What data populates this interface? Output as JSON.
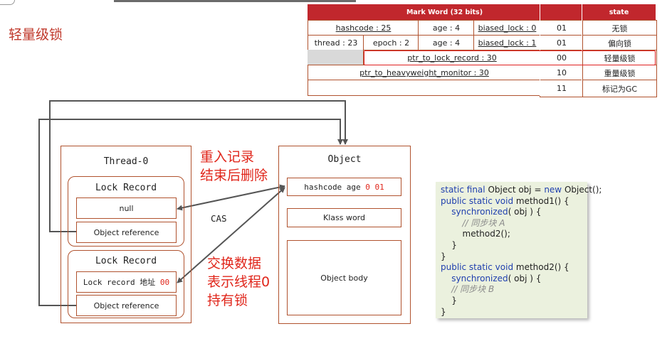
{
  "title": "轻量级锁",
  "mark_word": {
    "header": "Mark Word (32 bits)",
    "state_header": "state",
    "rows": [
      {
        "cells": [
          "hashcode : 25",
          "age : 4",
          "biased_lock : 0"
        ],
        "bits": "01",
        "state": "无锁"
      },
      {
        "cells": [
          "thread : 23",
          "epoch : 2",
          "age : 4",
          "biased_lock : 1"
        ],
        "bits": "01",
        "state": "偏向锁"
      },
      {
        "cells": [
          "ptr_to_lock_record : 30"
        ],
        "bits": "00",
        "state": "轻量级锁"
      },
      {
        "cells": [
          "ptr_to_heavyweight_monitor : 30"
        ],
        "bits": "10",
        "state": "重量级锁"
      },
      {
        "cells": [
          ""
        ],
        "bits": "11",
        "state": "标记为GC"
      }
    ]
  },
  "thread": {
    "title": "Thread-0",
    "lock_record_1": {
      "title": "Lock Record",
      "top_cell": "null",
      "bottom_cell": "Object reference"
    },
    "lock_record_2": {
      "title": "Lock Record",
      "top_cell_prefix": "Lock record 地址 ",
      "top_cell_value": "00",
      "bottom_cell": "Object reference"
    }
  },
  "object": {
    "title": "Object",
    "header_prefix": "hashcode age ",
    "header_value": "0 01",
    "klass": "Klass word",
    "body": "Object body"
  },
  "cas_label": "CAS",
  "note_top": [
    "重入记录",
    "结束后删除"
  ],
  "note_bottom": [
    "交换数据",
    "表示线程0",
    "持有锁"
  ],
  "code_lines": [
    "static final Object obj = new Object();",
    "public static void method1() {",
    "    synchronized( obj ) {",
    "        // 同步块 A",
    "        method2();",
    "    }",
    "}",
    "public static void method2() {",
    "    synchronized( obj ) {",
    "    // 同步块 B",
    "    }",
    "}"
  ],
  "colors": {
    "accent_red": "#e0261b",
    "box_border": "#b0522e",
    "table_header": "#c1272d",
    "arrow": "#555555"
  }
}
